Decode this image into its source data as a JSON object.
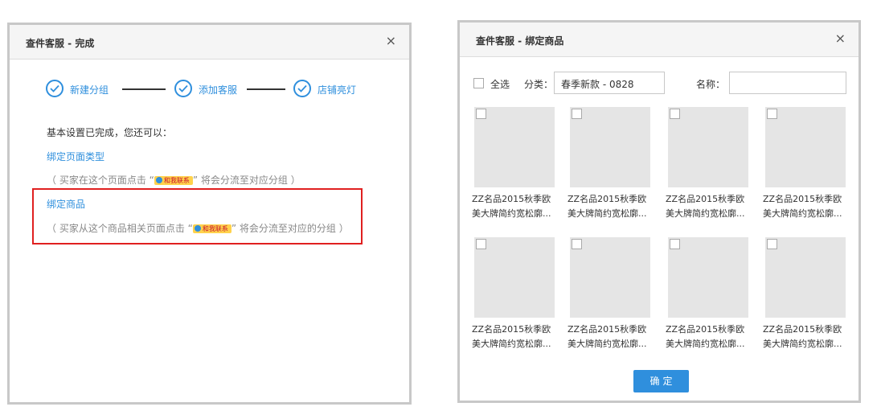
{
  "dialog_finish": {
    "title": "查件客服 - 完成",
    "close_glyph": "×",
    "steps": [
      {
        "label": "新建分组",
        "icon": "check-circle-icon"
      },
      {
        "label": "添加客服",
        "icon": "check-circle-icon"
      },
      {
        "label": "店铺亮灯",
        "icon": "check-circle-icon"
      }
    ],
    "intro": "基本设置已完成，您还可以：",
    "option_page": {
      "link": "绑定页面类型",
      "note_before": "（ 买家在这个页面点击 “",
      "note_after": "” 将会分流至对应分组 ）"
    },
    "option_goods": {
      "link": "绑定商品",
      "note_before": "（ 买家从这个商品相关页面点击 “",
      "note_after": "” 将会分流至对应的分组 ）"
    },
    "badge_text": "和我联系",
    "accent_color": "#2f8fdd",
    "highlight_color": "#e02020"
  },
  "dialog_bind": {
    "title": "查件客服 - 绑定商品",
    "close_glyph": "×",
    "select_all_label": "全选",
    "category_label": "分类：",
    "category_value": "春季新款 - 0828",
    "name_label": "名称：",
    "name_value": "",
    "products": [
      {
        "line1": "ZZ名品2015秋季欧",
        "line2": "美大牌简约宽松廓..."
      },
      {
        "line1": "ZZ名品2015秋季欧",
        "line2": "美大牌简约宽松廓..."
      },
      {
        "line1": "ZZ名品2015秋季欧",
        "line2": "美大牌简约宽松廓..."
      },
      {
        "line1": "ZZ名品2015秋季欧",
        "line2": "美大牌简约宽松廓..."
      },
      {
        "line1": "ZZ名品2015秋季欧",
        "line2": "美大牌简约宽松廓..."
      },
      {
        "line1": "ZZ名品2015秋季欧",
        "line2": "美大牌简约宽松廓..."
      },
      {
        "line1": "ZZ名品2015秋季欧",
        "line2": "美大牌简约宽松廓..."
      },
      {
        "line1": "ZZ名品2015秋季欧",
        "line2": "美大牌简约宽松廓..."
      }
    ],
    "confirm_label": "确定"
  }
}
